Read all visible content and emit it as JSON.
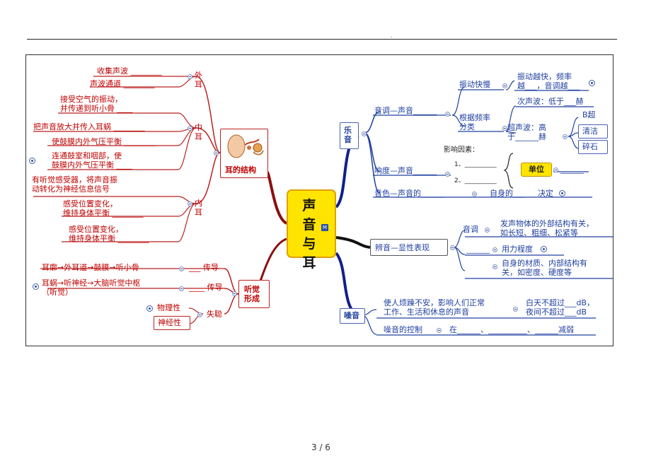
{
  "header_dot": ".",
  "page_number": "3 / 6",
  "center": {
    "title": "声音与耳",
    "badge": "M"
  },
  "left": {
    "ear_structure": {
      "label": "耳的结构",
      "outer_ear": {
        "label": "外\n耳",
        "items": [
          "收集声波 ________",
          "声波通道 ________"
        ]
      },
      "middle_ear": {
        "label": "中\n耳",
        "items": [
          "接受空气的振动，\n并传递到听小骨 ____",
          "把声音放大并传入耳蜗 ________",
          "使鼓膜内外气压平衡 ________",
          "连通鼓室和咽部，使\n鼓膜内外气压平衡 ____"
        ]
      },
      "inner_ear": {
        "label": "内\n耳",
        "items": [
          "有听觉感受器，将声音振\n动转化为神经信息信号",
          "感受位置变化，\n维持身体平衡 ________",
          "感受位置变化，\n维持身体平衡 ________"
        ]
      }
    },
    "hearing": {
      "label": "听觉\n形成",
      "path1": {
        "text": "耳廓→外耳道→鼓膜→听小骨",
        "suffix": "___ 传导"
      },
      "path2": {
        "text": "耳蜗→听神经→大脑听觉中枢\n（听觉）",
        "suffix": "____ 传导"
      },
      "deafness": {
        "label": "失聪",
        "items": [
          "物理性",
          "神经性"
        ]
      }
    }
  },
  "right": {
    "music": {
      "label": "乐\n音",
      "pitch": {
        "label": "音调—声音______",
        "vibration": "振动快慢",
        "vibration_detail": "振动越快，频率\n越___，音调越___",
        "classify": "根据频率\n分类",
        "infrasound": "次声波：低于___赫",
        "ultrasound": "超声波：高\n于______赫",
        "uses": [
          "B超",
          "清洁",
          "碎石"
        ]
      },
      "loudness": {
        "label": "响度—声音______",
        "factors_title": "影响因素：",
        "factors": [
          "1、__________",
          "2、__________"
        ],
        "unit": "单位",
        "unit_blank": "______"
      },
      "timbre": {
        "text": "音色—声音的______",
        "mid": "自身的___",
        "end": "决定"
      }
    },
    "distinguish": {
      "label": "辨音—显性表现",
      "pitch": "音调",
      "pitch_detail": "发声物体的外部结构有关，\n如长短、粗细、松紧等",
      "effort_blank": "______",
      "effort": "用力程度",
      "material": "自身的材质、内部结构有\n关，如密度、硬度等"
    },
    "noise": {
      "label": "噪音",
      "desc": "使人烦躁不安，影响人们正常\n工作、生活和休息的声音",
      "limits": "白天不超过___dB，\n夜间不超过___dB",
      "control": "噪音的控制",
      "control_detail": "在______、__________、______减弱"
    }
  }
}
